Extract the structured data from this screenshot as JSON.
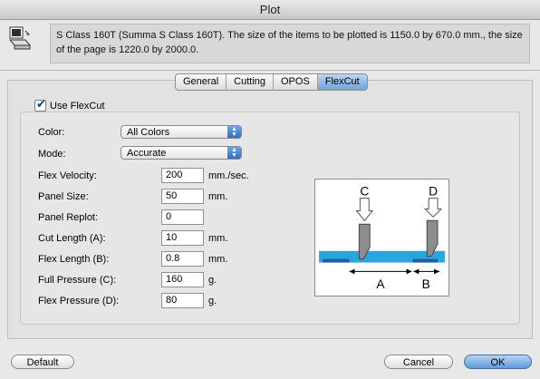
{
  "window": {
    "title": "Plot"
  },
  "info": {
    "text": "S Class 160T (Summa S Class 160T). The size of the items to be plotted is 1150.0 by 670.0 mm., the size of the page is 1220.0 by 2000.0."
  },
  "tabs": [
    {
      "label": "General",
      "active": false
    },
    {
      "label": "Cutting",
      "active": false
    },
    {
      "label": "OPOS",
      "active": false
    },
    {
      "label": "FlexCut",
      "active": true
    }
  ],
  "flexcut": {
    "use_label": "Use FlexCut",
    "use_checked": true,
    "color": {
      "label": "Color:",
      "value": "All Colors"
    },
    "mode": {
      "label": "Mode:",
      "value": "Accurate"
    },
    "fields": [
      {
        "label": "Flex Velocity:",
        "value": "200",
        "unit": "mm./sec."
      },
      {
        "label": "Panel Size:",
        "value": "50",
        "unit": "mm."
      },
      {
        "label": "Panel Replot:",
        "value": "0",
        "unit": ""
      },
      {
        "label": "Cut Length (A):",
        "value": "10",
        "unit": "mm."
      },
      {
        "label": "Flex Length (B):",
        "value": "0.8",
        "unit": "mm."
      },
      {
        "label": "Full Pressure (C):",
        "value": "160",
        "unit": "g."
      },
      {
        "label": "Flex Pressure (D):",
        "value": "80",
        "unit": "g."
      }
    ]
  },
  "diagram": {
    "c": "C",
    "d": "D",
    "a": "A",
    "b": "B"
  },
  "buttons": {
    "default": "Default",
    "cancel": "Cancel",
    "ok": "OK"
  },
  "colors": {
    "accent": "#5d9bdc",
    "diagram_blue": "#29a6df",
    "diagram_dark": "#1f5fa8"
  }
}
